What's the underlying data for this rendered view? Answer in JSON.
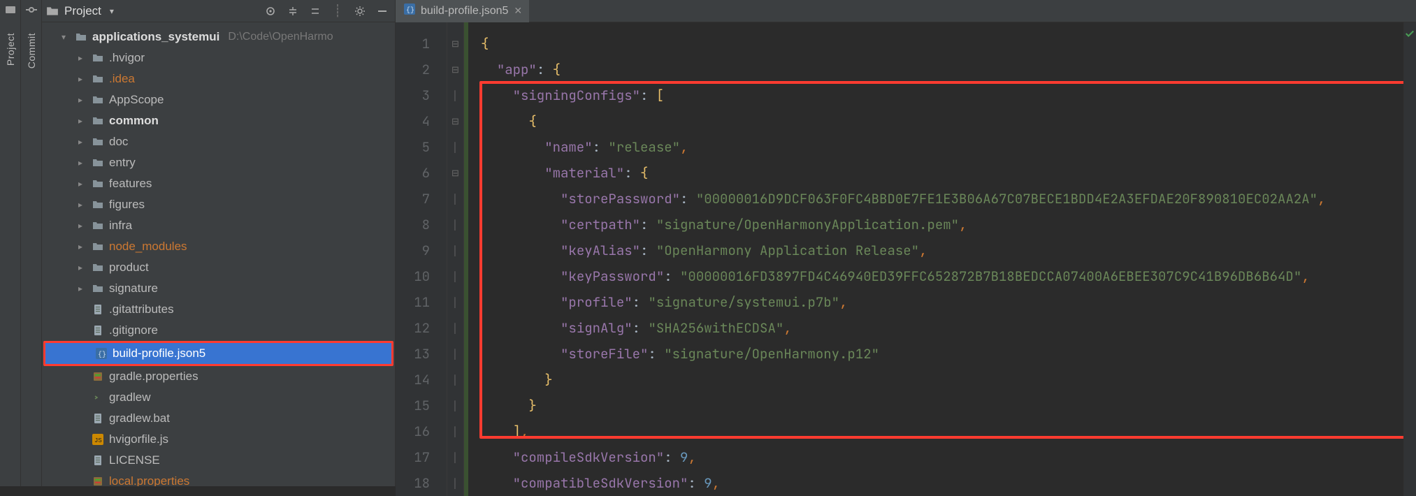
{
  "side_tabs": {
    "project": "Project",
    "commit": "Commit"
  },
  "project_panel": {
    "title": "Project",
    "root": {
      "name": "applications_systemui",
      "path": "D:\\Code\\OpenHarmo"
    },
    "folders": [
      {
        "name": ".hvigor"
      },
      {
        "name": ".idea",
        "accent": true
      },
      {
        "name": "AppScope"
      },
      {
        "name": "common",
        "bold": true
      },
      {
        "name": "doc"
      },
      {
        "name": "entry"
      },
      {
        "name": "features"
      },
      {
        "name": "figures"
      },
      {
        "name": "infra"
      },
      {
        "name": "node_modules",
        "accent": true
      },
      {
        "name": "product"
      },
      {
        "name": "signature"
      }
    ],
    "files": [
      {
        "name": ".gitattributes",
        "kind": "txt"
      },
      {
        "name": ".gitignore",
        "kind": "txt"
      },
      {
        "name": "build-profile.json5",
        "kind": "json",
        "selected": true
      },
      {
        "name": "gradle.properties",
        "kind": "prop"
      },
      {
        "name": "gradlew",
        "kind": "sh"
      },
      {
        "name": "gradlew.bat",
        "kind": "txt"
      },
      {
        "name": "hvigorfile.js",
        "kind": "js"
      },
      {
        "name": "LICENSE",
        "kind": "txt"
      },
      {
        "name": "local.properties",
        "kind": "prop",
        "accent": true
      }
    ]
  },
  "editor": {
    "tab_label": "build-profile.json5",
    "line_numbers": [
      1,
      2,
      3,
      4,
      5,
      6,
      7,
      8,
      9,
      10,
      11,
      12,
      13,
      14,
      15,
      16,
      17,
      18
    ],
    "json5": {
      "app": "app",
      "signingConfigs": "signingConfigs",
      "name_key": "name",
      "name_val": "release",
      "material": "material",
      "storePassword_key": "storePassword",
      "storePassword_val": "00000016D9DCF063F0FC4BBD0E7FE1E3B06A67C07BECE1BDD4E2A3EFDAE20F890810EC02AA2A",
      "certpath_key": "certpath",
      "certpath_val": "signature/OpenHarmonyApplication.pem",
      "keyAlias_key": "keyAlias",
      "keyAlias_val": "OpenHarmony Application Release",
      "keyPassword_key": "keyPassword",
      "keyPassword_val": "00000016FD3897FD4C46940ED39FFC652872B7B18BEDCCA07400A6EBEE307C9C41B96DB6B64D",
      "profile_key": "profile",
      "profile_val": "signature/systemui.p7b",
      "signAlg_key": "signAlg",
      "signAlg_val": "SHA256withECDSA",
      "storeFile_key": "storeFile",
      "storeFile_val": "signature/OpenHarmony.p12",
      "compileSdkVersion_key": "compileSdkVersion",
      "compileSdkVersion_val": 9,
      "compatibleSdkVersion_key": "compatibleSdkVersion",
      "compatibleSdkVersion_val": 9
    }
  }
}
